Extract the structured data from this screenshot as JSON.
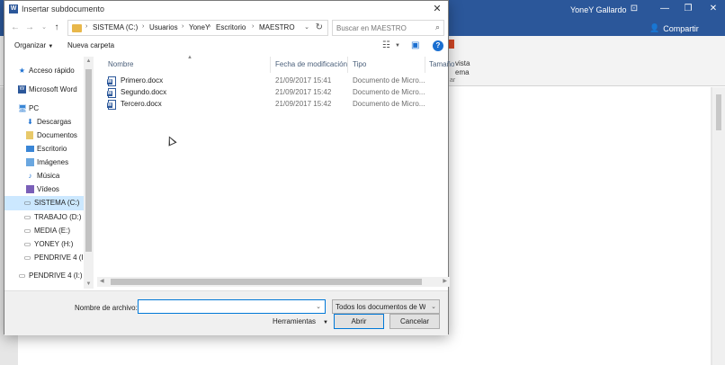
{
  "word": {
    "user_name": "YoneY Gallardo",
    "share_label": "Compartir",
    "ribbon_fragment_1": "vista",
    "ribbon_fragment_2": "ema",
    "ribbon_fragment_3": "ar",
    "accent": "#2b579a"
  },
  "dialog": {
    "title": "Insertar subdocumento",
    "close_glyph": "✕",
    "nav": {
      "breadcrumbs": [
        "SISTEMA (C:)",
        "Usuarios",
        "YoneY",
        "Escritorio",
        "MAESTRO"
      ],
      "search_placeholder": "Buscar en MAESTRO"
    },
    "toolbar": {
      "organize_label": "Organizar",
      "new_folder_label": "Nueva carpeta",
      "help_glyph": "?"
    },
    "sidebar": {
      "items": [
        {
          "label": "Acceso rápido",
          "icon": "star-icon"
        },
        {
          "label": "Microsoft Word",
          "icon": "word-icon"
        },
        {
          "label": "PC",
          "icon": "pc-icon"
        },
        {
          "label": "Descargas",
          "icon": "downloads-icon"
        },
        {
          "label": "Documentos",
          "icon": "documents-icon"
        },
        {
          "label": "Escritorio",
          "icon": "desktop-icon"
        },
        {
          "label": "Imágenes",
          "icon": "pictures-icon"
        },
        {
          "label": "Música",
          "icon": "music-icon"
        },
        {
          "label": "Vídeos",
          "icon": "videos-icon"
        },
        {
          "label": "SISTEMA (C:)",
          "icon": "drive-c-icon",
          "selected": true
        },
        {
          "label": "TRABAJO (D:)",
          "icon": "drive-icon"
        },
        {
          "label": "MEDIA (E:)",
          "icon": "drive-icon"
        },
        {
          "label": "YONEY (H:)",
          "icon": "drive-icon"
        },
        {
          "label": "PENDRIVE 4 (I:)",
          "icon": "usb-icon"
        },
        {
          "label": "PENDRIVE 4 (I:)",
          "icon": "usb-icon"
        }
      ]
    },
    "columns": [
      "Nombre",
      "Fecha de modificación",
      "Tipo",
      "Tamaño"
    ],
    "files": [
      {
        "name": "Primero.docx",
        "date": "21/09/2017 15:41",
        "type": "Documento de Micro..."
      },
      {
        "name": "Segundo.docx",
        "date": "21/09/2017 15:42",
        "type": "Documento de Micro..."
      },
      {
        "name": "Tercero.docx",
        "date": "21/09/2017 15:42",
        "type": "Documento de Micro..."
      }
    ],
    "footer": {
      "filename_label": "Nombre de archivo:",
      "filename_value": "",
      "filter_value": "Todos los documentos de Word",
      "tools_label": "Herramientas",
      "open_label": "Abrir",
      "cancel_label": "Cancelar"
    }
  }
}
